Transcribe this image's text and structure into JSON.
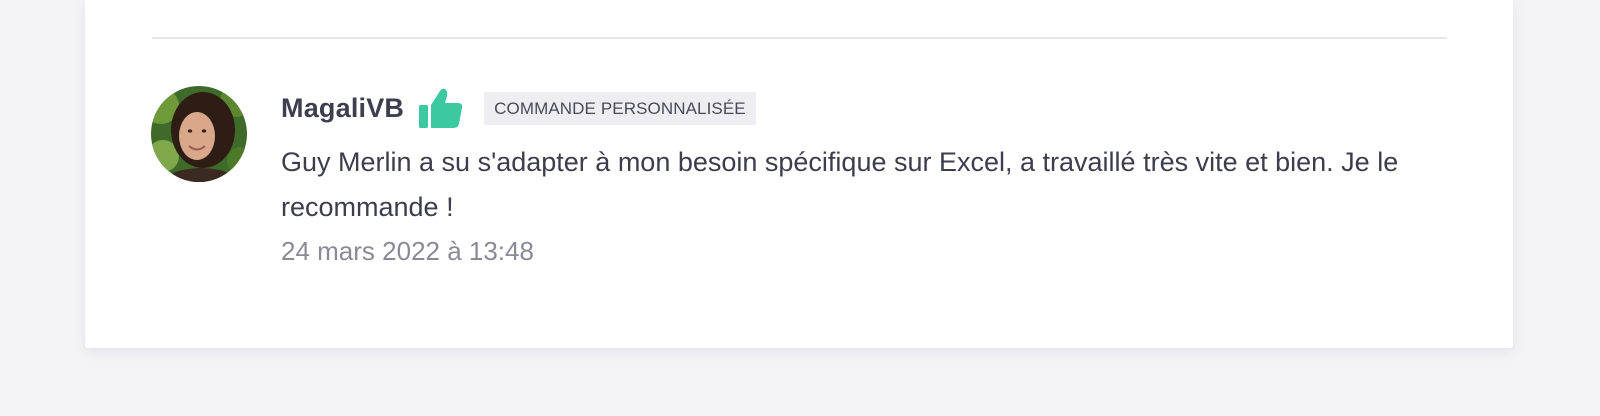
{
  "review": {
    "author": "MagaliVB",
    "badge": "COMMANDE PERSONNALISÉE",
    "rating_icon": "thumbs-up-icon",
    "text": "Guy Merlin a su s'adapter à mon besoin spécifique sur Excel, a travaillé très vite et bien. Je le recommande !",
    "date": "24 mars 2022 à 13:48"
  },
  "colors": {
    "thumb": "#3cc9a2",
    "text": "#3d3d4d",
    "muted": "#8a8a96",
    "badge_bg": "#eeeef2",
    "page_bg": "#f4f4f7"
  }
}
